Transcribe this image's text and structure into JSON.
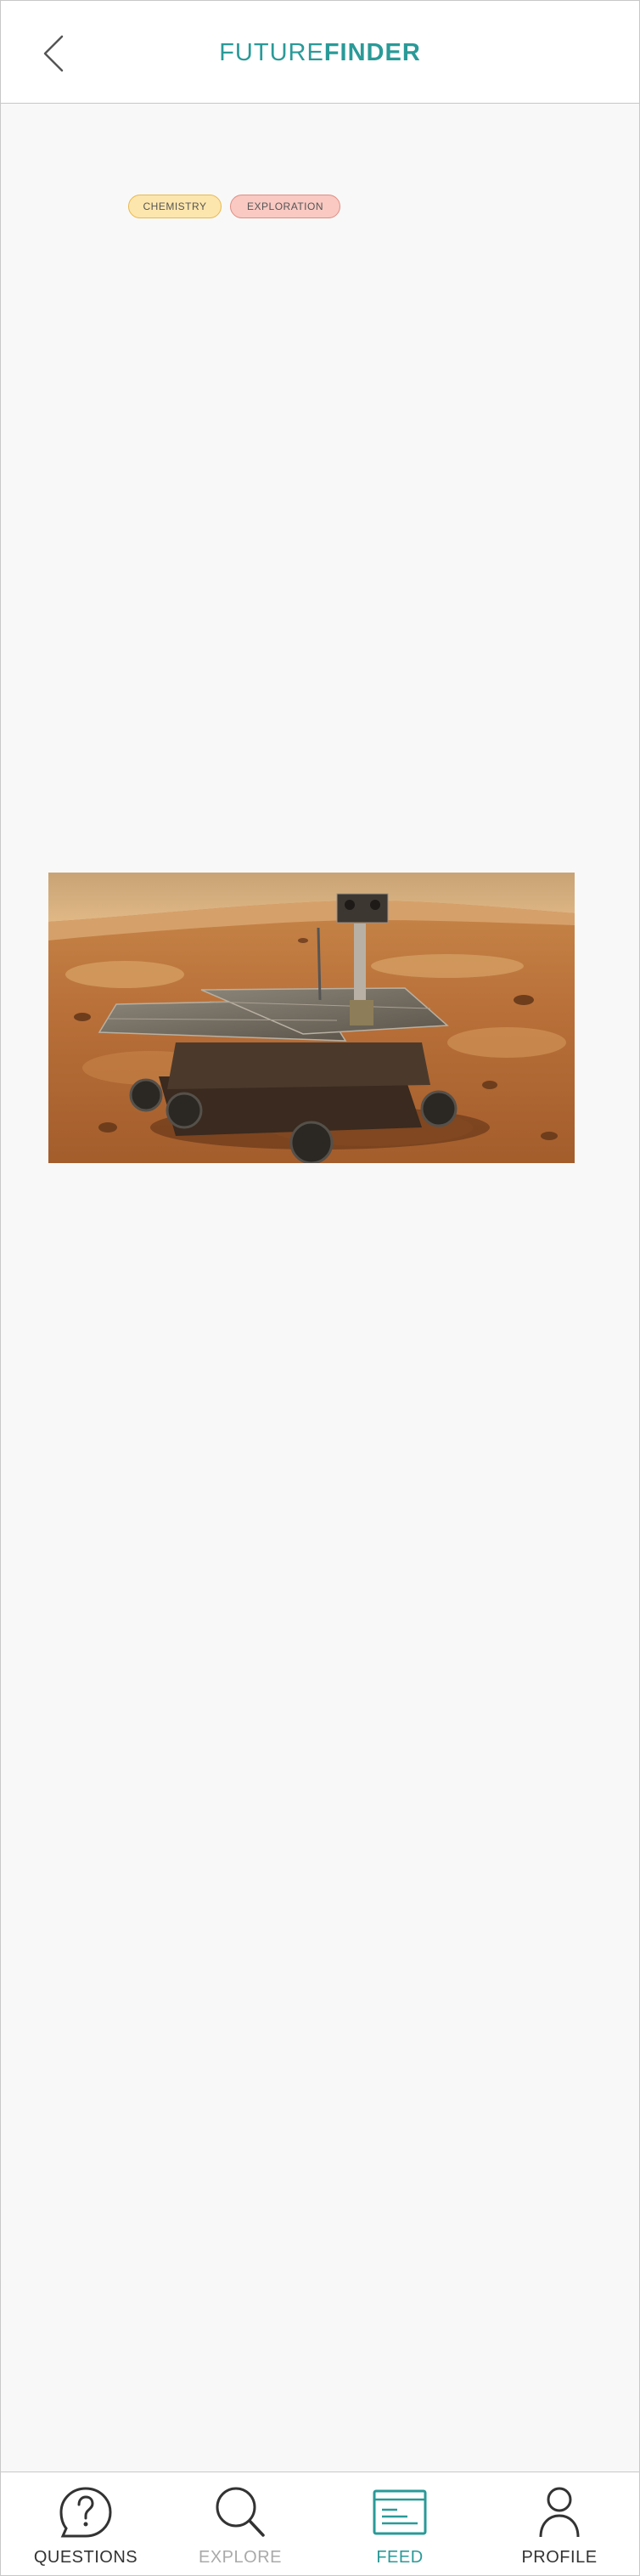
{
  "header": {
    "logo_light": "FUTURE",
    "logo_bold": "FINDER",
    "back_icon": "chevron-left-icon"
  },
  "tags": [
    {
      "label": "CHEMISTRY",
      "color": "#fde6ad",
      "border": "#e7b94e"
    },
    {
      "label": "EXPLORATION",
      "color": "#f9c9c2",
      "border": "#e08e83"
    }
  ],
  "media": {
    "image": "mars-rover-illustration"
  },
  "bottom_nav": {
    "items": [
      {
        "label": "QUESTIONS",
        "icon": "question-bubble-icon",
        "active": false,
        "color": "#333333"
      },
      {
        "label": "EXPLORE",
        "icon": "search-icon",
        "active": false,
        "color": "#aaaaaa"
      },
      {
        "label": "FEED",
        "icon": "feed-icon",
        "active": true,
        "color": "#2a9a98"
      },
      {
        "label": "PROFILE",
        "icon": "user-icon",
        "active": false,
        "color": "#333333"
      }
    ]
  },
  "colors": {
    "accent": "#2a9a98",
    "background": "#f8f8f8"
  }
}
